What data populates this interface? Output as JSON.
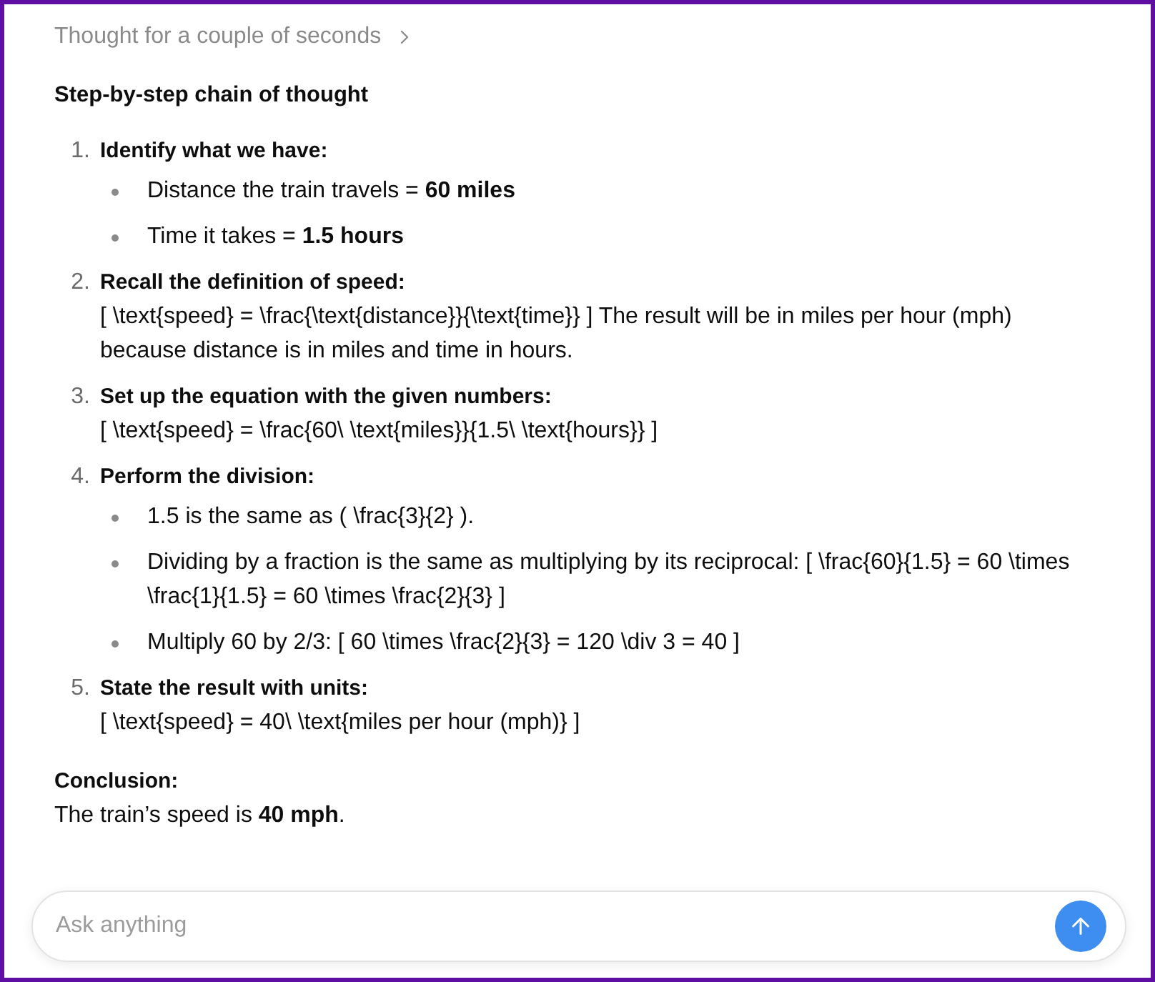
{
  "thought": {
    "label": "Thought for a couple of seconds"
  },
  "title": "Step-by-step chain of thought",
  "steps": [
    {
      "number": "1.",
      "heading": "Identify what we have:",
      "bullets": [
        "Distance the train travels = **60 miles**",
        "Time it takes = **1.5 hours**"
      ]
    },
    {
      "number": "2.",
      "heading": "Recall the definition of speed:",
      "body": "[ \\text{speed} = \\frac{\\text{distance}}{\\text{time}} ] The result will be in miles per hour (mph) because distance is in miles and time in hours."
    },
    {
      "number": "3.",
      "heading": "Set up the equation with the given numbers:",
      "body": "[ \\text{speed} = \\frac{60\\ \\text{miles}}{1.5\\ \\text{hours}} ]"
    },
    {
      "number": "4.",
      "heading": "Perform the division:",
      "bullets": [
        "1.5 is the same as ( \\frac{3}{2} ).",
        "Dividing by a fraction is the same as multiplying by its reciprocal: [ \\frac{60}{1.5} = 60 \\times \\frac{1}{1.5} = 60 \\times \\frac{2}{3} ]",
        "Multiply 60 by 2/3: [ 60 \\times \\frac{2}{3} = 120 \\div 3 = 40 ]"
      ]
    },
    {
      "number": "5.",
      "heading": "State the result with units:",
      "body": "[ \\text{speed} = 40\\ \\text{miles per hour (mph)} ]"
    }
  ],
  "conclusion": {
    "label": "Conclusion:",
    "text": "The train’s speed is **40 mph**."
  },
  "composer": {
    "placeholder": "Ask anything"
  }
}
